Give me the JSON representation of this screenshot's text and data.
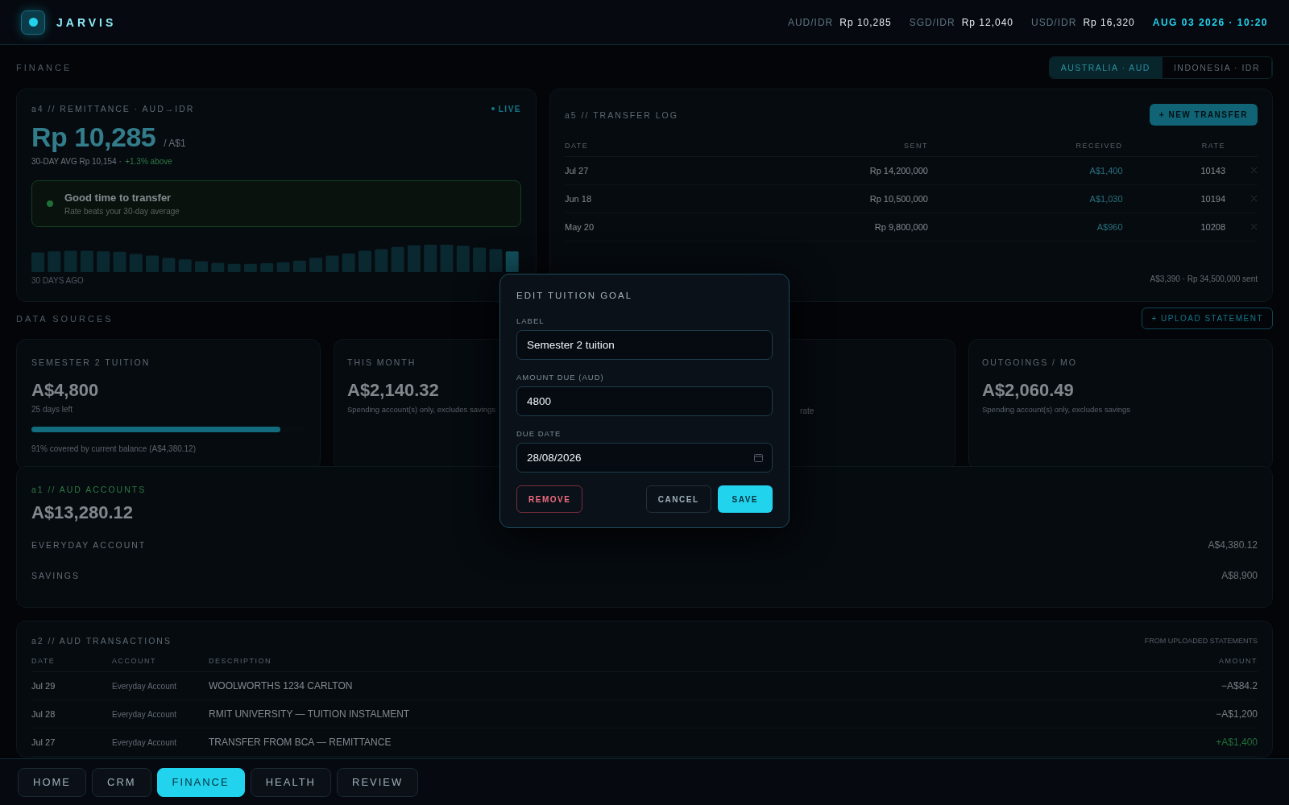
{
  "topbar": {
    "logo": "JARVIS",
    "rates": [
      {
        "pair": "AUD/IDR",
        "value": "Rp 10,285"
      },
      {
        "pair": "SGD/IDR",
        "value": "Rp 12,040"
      },
      {
        "pair": "USD/IDR",
        "value": "Rp 16,320"
      }
    ],
    "datetime": "AUG 03 2026 · 10:20"
  },
  "page": {
    "title": "FINANCE",
    "regions": [
      {
        "label": "AUSTRALIA · AUD",
        "selected": true
      },
      {
        "label": "INDONESIA · IDR",
        "selected": false
      }
    ]
  },
  "remittance": {
    "header": "a4 // REMITTANCE · AUD→IDR",
    "live": "LIVE",
    "rate": "Rp 10,285",
    "unit": "/ A$1",
    "average": "30-DAY AVG Rp 10,154 ·",
    "change": "+1.3% above",
    "signal": {
      "title": "Good time to transfer",
      "subtitle": "Rate beats your 30-day average"
    },
    "chart_caption": "30 DAYS AGO"
  },
  "transfer_log": {
    "title": "a5 // TRANSFER LOG",
    "button": "+ NEW TRANSFER",
    "columns": [
      "DATE",
      "SENT",
      "RECEIVED",
      "RATE"
    ],
    "rows": [
      {
        "date": "Jul 27",
        "sent": "Rp 14,200,000",
        "received": "A$1,400",
        "rate": "10143"
      },
      {
        "date": "Jun 18",
        "sent": "Rp 10,500,000",
        "received": "A$1,030",
        "rate": "10194"
      },
      {
        "date": "May 20",
        "sent": "Rp 9,800,000",
        "received": "A$960",
        "rate": "10208"
      }
    ],
    "total": "A$3,390 · Rp 34,500,000 sent"
  },
  "data_sources": {
    "title": "DATA SOURCES",
    "button": "+ UPLOAD STATEMENT",
    "cards": [
      {
        "kind": "goal",
        "label": "SEMESTER 2 TUITION",
        "amount": "A$4,800",
        "note": "25 days left",
        "level": 0.91,
        "caption": "91% covered by current balance (A$4,380.12)"
      },
      {
        "kind": "stat",
        "label": "THIS MONTH",
        "amount": "A$2,140.32",
        "note": "Spending account(s) only, excludes savings"
      },
      {
        "kind": "partial",
        "note": "rate"
      },
      {
        "kind": "stat",
        "label": "OUTGOINGS / MO",
        "amount": "A$2,060.49",
        "note": "Spending account(s) only, excludes savings"
      }
    ]
  },
  "accounts": {
    "title": "a1 // AUD ACCOUNTS",
    "total": "A$13,280.12",
    "rows": [
      {
        "name": "EVERYDAY ACCOUNT",
        "balance": "A$4,380.12"
      },
      {
        "name": "SAVINGS",
        "balance": "A$8,900"
      }
    ]
  },
  "transactions": {
    "title": "a2 // AUD TRANSACTIONS",
    "source": "FROM UPLOADED STATEMENTS",
    "columns": [
      "DATE",
      "ACCOUNT",
      "DESCRIPTION",
      "AMOUNT"
    ],
    "rows": [
      {
        "date": "Jul 29",
        "account": "Everyday Account",
        "description": "WOOLWORTHS 1234 CARLTON",
        "amount": "−A$84.2",
        "kind": "debit"
      },
      {
        "date": "Jul 28",
        "account": "Everyday Account",
        "description": "RMIT UNIVERSITY — TUITION INSTALMENT",
        "amount": "−A$1,200",
        "kind": "debit"
      },
      {
        "date": "Jul 27",
        "account": "Everyday Account",
        "description": "TRANSFER FROM BCA — REMITTANCE",
        "amount": "+A$1,400",
        "kind": "credit"
      }
    ]
  },
  "modal": {
    "title": "EDIT TUITION GOAL",
    "fields": [
      {
        "label": "LABEL",
        "value": "Semester 2 tuition",
        "kind": "text"
      },
      {
        "label": "AMOUNT DUE (AUD)",
        "value": "4800",
        "kind": "text"
      },
      {
        "label": "DUE DATE",
        "value": "28/08/2026",
        "kind": "date"
      }
    ],
    "remove": "REMOVE",
    "cancel": "CANCEL",
    "save": "SAVE"
  },
  "nav": [
    {
      "label": "HOME",
      "selected": false
    },
    {
      "label": "CRM",
      "selected": false
    },
    {
      "label": "FINANCE",
      "selected": true
    },
    {
      "label": "HEALTH",
      "selected": false
    },
    {
      "label": "REVIEW",
      "selected": false
    }
  ]
}
